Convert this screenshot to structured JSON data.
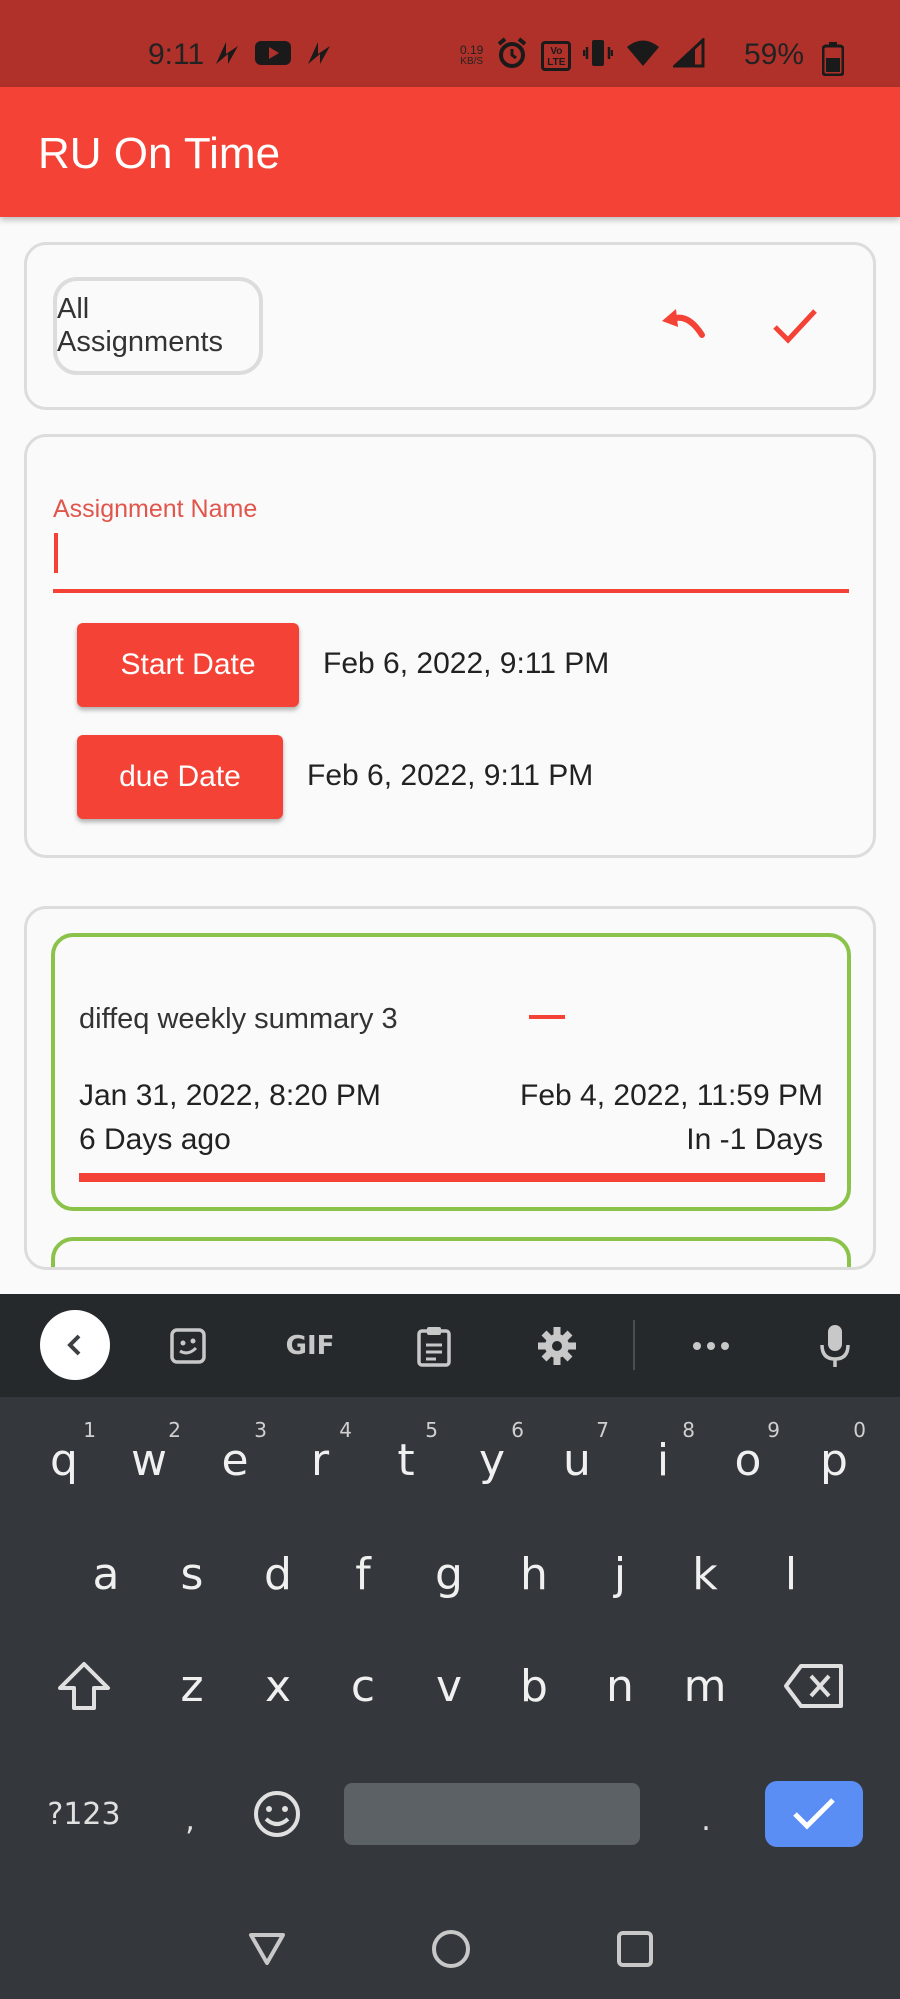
{
  "status_bar": {
    "time": "9:11",
    "net_speed_value": "0.19",
    "net_speed_unit": "KB/S",
    "volte_label": "Vo LTE",
    "battery": "59%",
    "left_icons": [
      "signal-relay-icon",
      "youtube-icon",
      "signal-relay-icon"
    ],
    "right_icons": [
      "alarm-icon",
      "volte-icon",
      "vibrate-icon",
      "wifi-icon",
      "cell-signal-icon",
      "battery-icon"
    ]
  },
  "app_bar": {
    "title": "RU On Time"
  },
  "filter": {
    "chip_label": "All Assignments",
    "undo_icon": "undo-icon",
    "confirm_icon": "check-icon"
  },
  "form": {
    "name_label": "Assignment Name",
    "name_value": "",
    "start_button": "Start Date",
    "start_value": "Feb 6, 2022, 9:11 PM",
    "due_button": "due Date",
    "due_value": "Feb 6, 2022, 9:11 PM"
  },
  "assignments": [
    {
      "name": "diffeq weekly summary 3",
      "start": "Jan 31, 2022, 8:20 PM",
      "due": "Feb 4, 2022, 11:59 PM",
      "ago": "6 Days ago",
      "remaining": "In -1 Days",
      "progress": 1.0
    }
  ],
  "colors": {
    "primary": "#f44336",
    "status_bar": "#b0312a",
    "card_border_green": "#8bc34a",
    "keyboard_bg": "#34383c",
    "keyboard_enter": "#5b8ef5"
  },
  "keyboard": {
    "toolbar": [
      "back-icon",
      "sticker-icon",
      "gif",
      "clipboard-icon",
      "gear-icon",
      "more-icon",
      "mic-icon"
    ],
    "gif_label": "GIF",
    "row1": [
      "q",
      "w",
      "e",
      "r",
      "t",
      "y",
      "u",
      "i",
      "o",
      "p"
    ],
    "row1_hints": [
      "1",
      "2",
      "3",
      "4",
      "5",
      "6",
      "7",
      "8",
      "9",
      "0"
    ],
    "row2": [
      "a",
      "s",
      "d",
      "f",
      "g",
      "h",
      "j",
      "k",
      "l"
    ],
    "row3": [
      "z",
      "x",
      "c",
      "v",
      "b",
      "n",
      "m"
    ],
    "symbols_key": "?123",
    "comma_key": ",",
    "period_key": "."
  },
  "nav_bar": [
    "back-triangle-icon",
    "home-circle-icon",
    "recents-square-icon"
  ]
}
